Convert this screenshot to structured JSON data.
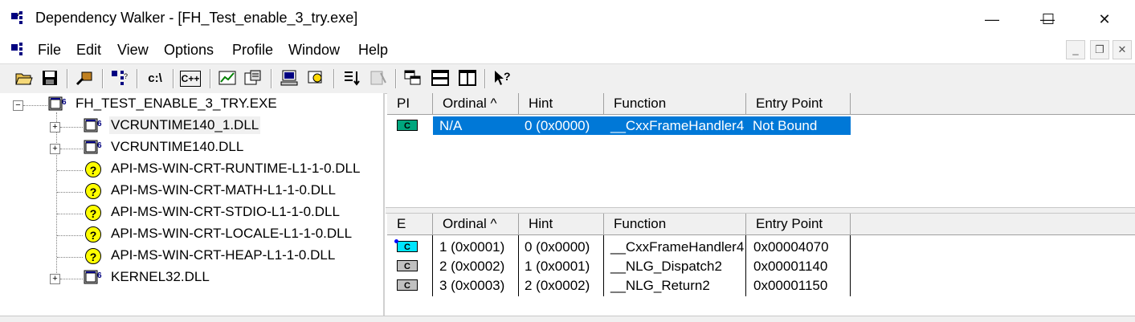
{
  "window": {
    "title": "Dependency Walker - [FH_Test_enable_3_try.exe]",
    "controls": {
      "minimize": "—",
      "maximize": "☐",
      "close": "✕"
    },
    "mdi_controls": {
      "minimize": "_",
      "restore": "❐",
      "close": "✕"
    }
  },
  "menu": {
    "items": [
      "File",
      "Edit",
      "View",
      "Options",
      "Profile",
      "Window",
      "Help"
    ]
  },
  "toolbar": {
    "buttons": [
      "open-icon",
      "save-icon",
      "find-icon",
      "tree-icon",
      "path-icon",
      "cpp-icon",
      "chart-icon",
      "properties-icon",
      "system-icon",
      "search-icon",
      "sort-icon",
      "auto-expand-icon",
      "cascade-icon",
      "tile-horizontal-icon",
      "tile-vertical-icon",
      "context-help-icon"
    ],
    "path_label": "c:\\",
    "cpp_label": "C++"
  },
  "tree": {
    "root": {
      "label": "FH_TEST_ENABLE_3_TRY.EXE",
      "expander": "−"
    },
    "children": [
      {
        "label": "VCRUNTIME140_1.DLL",
        "expander": "+",
        "type": "module",
        "selected": true
      },
      {
        "label": "VCRUNTIME140.DLL",
        "expander": "+",
        "type": "module"
      },
      {
        "label": "API-MS-WIN-CRT-RUNTIME-L1-1-0.DLL",
        "type": "missing",
        "icon": "?"
      },
      {
        "label": "API-MS-WIN-CRT-MATH-L1-1-0.DLL",
        "type": "missing",
        "icon": "?"
      },
      {
        "label": "API-MS-WIN-CRT-STDIO-L1-1-0.DLL",
        "type": "missing",
        "icon": "?"
      },
      {
        "label": "API-MS-WIN-CRT-LOCALE-L1-1-0.DLL",
        "type": "missing",
        "icon": "?"
      },
      {
        "label": "API-MS-WIN-CRT-HEAP-L1-1-0.DLL",
        "type": "missing",
        "icon": "?"
      },
      {
        "label": "KERNEL32.DLL",
        "expander": "+",
        "type": "module"
      }
    ]
  },
  "imports": {
    "headers": [
      "PI",
      "Ordinal ^",
      "Hint",
      "Function",
      "Entry Point"
    ],
    "rows": [
      {
        "icon": "C",
        "ordinal": "N/A",
        "hint": "0 (0x0000)",
        "function": "__CxxFrameHandler4",
        "entry": "Not Bound",
        "selected": true
      }
    ],
    "icon_color": "#00a67e"
  },
  "exports": {
    "headers": [
      "E",
      "Ordinal ^",
      "Hint",
      "Function",
      "Entry Point"
    ],
    "rows": [
      {
        "icon": "C",
        "ordinal": "1 (0x0001)",
        "hint": "0 (0x0000)",
        "function": "__CxxFrameHandler4",
        "entry": "0x00004070",
        "highlight": true
      },
      {
        "icon": "C",
        "ordinal": "2 (0x0002)",
        "hint": "1 (0x0001)",
        "function": "__NLG_Dispatch2",
        "entry": "0x00001140"
      },
      {
        "icon": "C",
        "ordinal": "3 (0x0003)",
        "hint": "2 (0x0002)",
        "function": "__NLG_Return2",
        "entry": "0x00001150"
      }
    ],
    "icon_color_highlight": "#00e5ff",
    "icon_color_normal": "#c0c0c0"
  },
  "colors": {
    "selection": "#0078d7",
    "missing_icon": "#ffff00"
  }
}
